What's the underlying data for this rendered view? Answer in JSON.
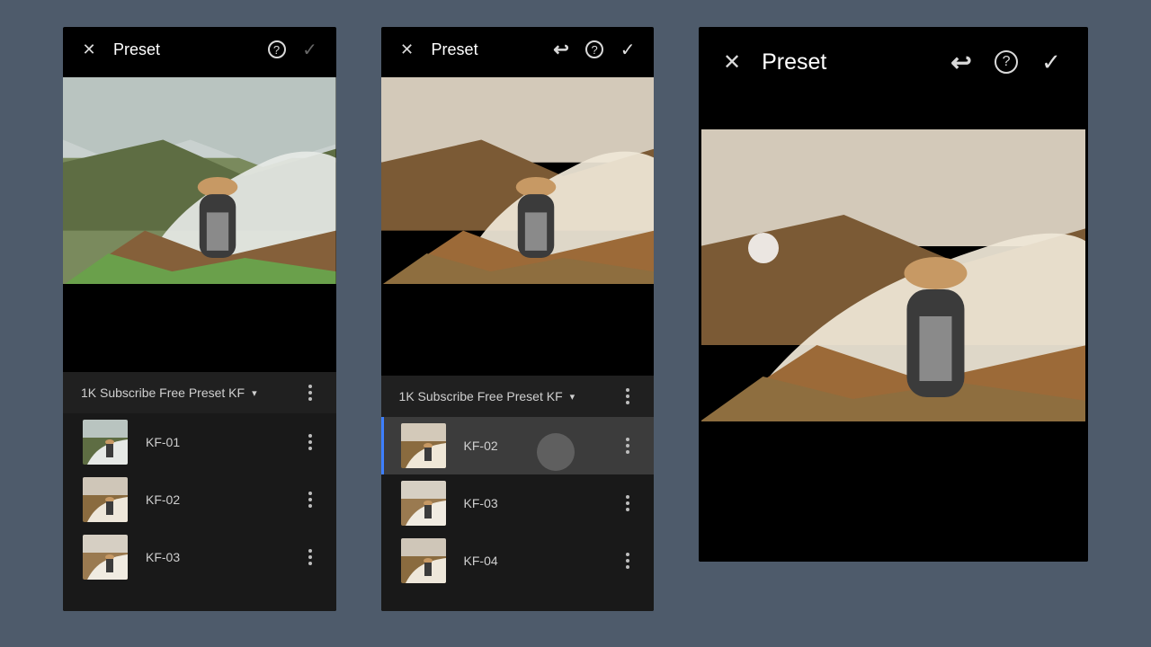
{
  "screens": {
    "a": {
      "title": "Preset",
      "group": "1K Subscribe Free Preset KF",
      "presets": [
        "KF-01",
        "KF-02",
        "KF-03"
      ]
    },
    "b": {
      "title": "Preset",
      "group": "1K Subscribe Free Preset KF",
      "presets": [
        "KF-02",
        "KF-03",
        "KF-04"
      ]
    },
    "c": {
      "title": "Preset"
    }
  },
  "icons": {
    "undo": "↩",
    "help": "?",
    "chevron": "▾"
  }
}
